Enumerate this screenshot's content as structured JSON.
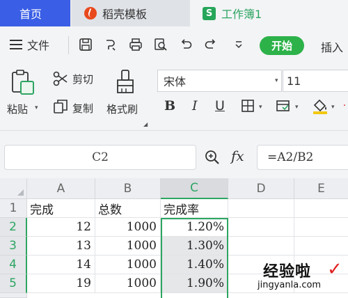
{
  "tabs": [
    {
      "label": "首页"
    },
    {
      "label": "稻壳模板"
    },
    {
      "label": "工作簿1",
      "icon_letter": "S"
    }
  ],
  "menu": {
    "file_label": "文件",
    "start_label": "开始",
    "insert_label": "插入",
    "quick_access_icons": [
      "save-icon",
      "format-painter-redo-icon",
      "print-icon",
      "print-preview-icon",
      "undo-icon",
      "redo-icon",
      "more-dropdown-icon"
    ]
  },
  "ribbon": {
    "paste_label": "粘贴",
    "cut_label": "剪切",
    "copy_label": "复制",
    "format_painter_label": "格式刷",
    "font_name": "宋体",
    "font_size": "11",
    "bold_label": "B",
    "italic_label": "I",
    "underline_label": "U"
  },
  "formula_bar": {
    "name_box": "C2",
    "fx_label": "fx",
    "formula": "=A2/B2"
  },
  "sheet": {
    "columns": [
      "A",
      "B",
      "C",
      "D",
      "E"
    ],
    "selected_column": "C",
    "rows": [
      {
        "num": "1",
        "cells": [
          "完成",
          "总数",
          "完成率",
          "",
          ""
        ]
      },
      {
        "num": "2",
        "cells": [
          "12",
          "1000",
          "1.20%",
          "",
          ""
        ]
      },
      {
        "num": "3",
        "cells": [
          "13",
          "1000",
          "1.30%",
          "",
          ""
        ]
      },
      {
        "num": "4",
        "cells": [
          "14",
          "1000",
          "1.40%",
          "",
          ""
        ]
      },
      {
        "num": "5",
        "cells": [
          "19",
          "1000",
          "1.90%",
          "",
          ""
        ]
      }
    ]
  },
  "watermark": {
    "text_cn": "经验啦",
    "url": "jingyanla.com"
  },
  "colors": {
    "home_tab": "#3a5ee5",
    "accent_green": "#2db24a",
    "selection_green": "#2da562",
    "brand_orange": "#e8491d"
  }
}
